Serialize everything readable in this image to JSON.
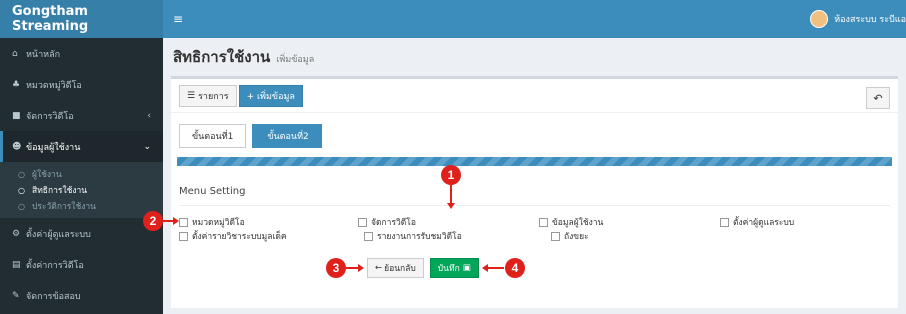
{
  "brand": "Gongtham Streaming",
  "topbar": {
    "user": "ห้องสระบบ ระบีแอ"
  },
  "sidebar": {
    "items": [
      {
        "label": "หน้าหลัก",
        "icon": "home-icon"
      },
      {
        "label": "หมวดหมู่วิดีโอ",
        "icon": "sitemap-icon"
      },
      {
        "label": "จัดการวิดีโอ",
        "icon": "video-icon"
      },
      {
        "label": "ข้อมูลผู้ใช้งาน",
        "icon": "users-icon"
      }
    ],
    "sub_items": [
      {
        "label": "ผู้ใช้งาน"
      },
      {
        "label": "สิทธิการใช้งาน"
      },
      {
        "label": "ประวัติการใช้งาน"
      }
    ],
    "items2": [
      {
        "label": "ตั้งค่าผู้ดูแลระบบ",
        "icon": "cogs-icon"
      },
      {
        "label": "ตั้งค่าการวิดีโอ",
        "icon": "file-icon"
      },
      {
        "label": "จัดการข้อสอบ",
        "icon": "edit-icon"
      }
    ]
  },
  "page": {
    "title": "สิทธิการใช้งาน",
    "subtitle": "เพิ่มข้อมูล"
  },
  "toolbar": {
    "list_label": "รายการ",
    "add_label": "+ เพิ่มข้อมูล"
  },
  "steps": {
    "step1": "ขั้นตอนที่1",
    "step2": "ขั้นตอนที่2"
  },
  "menu_setting": "Menu Setting",
  "checks": [
    [
      "หมวดหมู่วิดีโอ",
      "จัดการวิดีโอ",
      "ข้อมูลผู้ใช้งาน",
      "ตั้งค่าผู้ดูแลระบบ"
    ],
    [
      "ตั้งค่ารายวิชาระบบมูลเด็ค",
      "รายงานการรับชมวิดีโอ",
      "ถังขยะ",
      ""
    ]
  ],
  "buttons": {
    "back": "ย้อนกลับ",
    "save": "บันทึก"
  },
  "annotations": [
    "1",
    "2",
    "3",
    "4"
  ]
}
